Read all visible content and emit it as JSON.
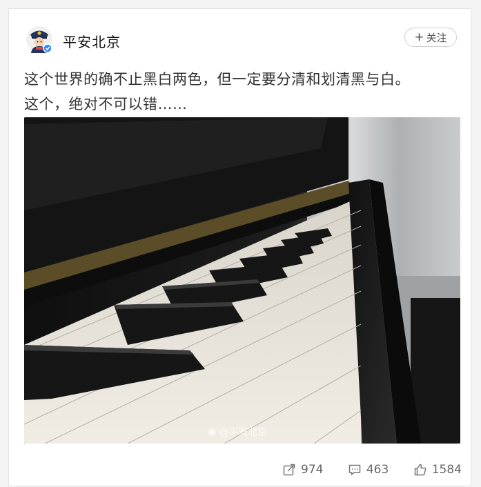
{
  "post": {
    "author": "平安北京",
    "follow_label": "关注",
    "text_line1": "这个世界的确不止黑白两色，但一定要分清和划清黑与白。",
    "text_line2": "这个，绝对不可以错……",
    "image_watermark": "@平安北京"
  },
  "stats": {
    "shares": "974",
    "comments": "463",
    "likes": "1584"
  },
  "icons": {
    "avatar": "police-avatar-icon",
    "verified": "verified-badge-icon",
    "share": "share-icon",
    "comment": "comment-icon",
    "like": "thumbs-up-icon",
    "watermark": "weibo-logo-icon"
  },
  "colors": {
    "verified_badge": "#2f8cff",
    "text": "#333333",
    "stats_text": "#666666"
  }
}
